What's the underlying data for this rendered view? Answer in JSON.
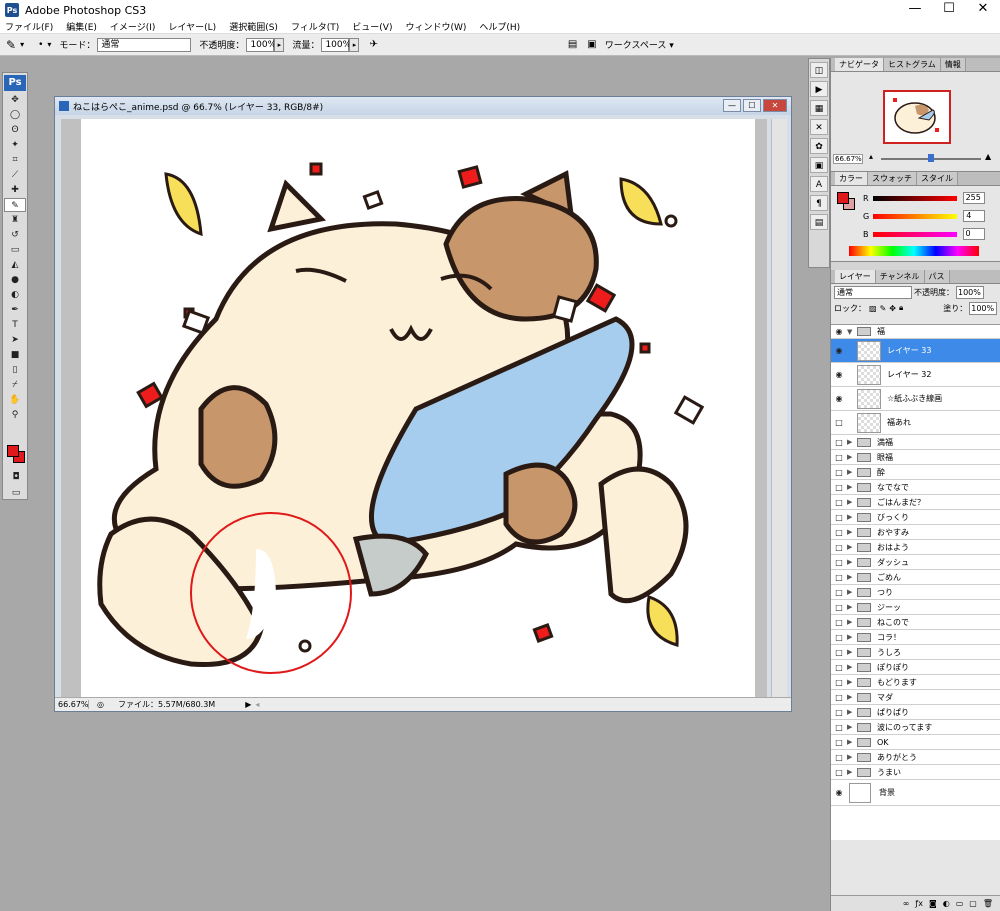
{
  "app": {
    "title": "Adobe Photoshop CS3",
    "logo": "Ps"
  },
  "window_controls": {
    "minimize": "—",
    "maximize": "☐",
    "close": "✕"
  },
  "menu": [
    "ファイル(F)",
    "編集(E)",
    "イメージ(I)",
    "レイヤー(L)",
    "選択範囲(S)",
    "フィルタ(T)",
    "ビュー(V)",
    "ウィンドウ(W)",
    "ヘルプ(H)"
  ],
  "options": {
    "mode_label": "モード：",
    "mode_value": "通常",
    "opacity_label": "不透明度：",
    "opacity_value": "100%",
    "flow_label": "流量：",
    "flow_value": "100%",
    "workspace_label": "ワークスペース ▾"
  },
  "toolbox": {
    "logo": "Ps"
  },
  "document": {
    "title": "ねこはらぺこ_anime.psd @ 66.7% (レイヤー 33, RGB/8#)",
    "zoom": "66.67%",
    "file_info": "ファイル：5.57M/680.3M"
  },
  "navigator": {
    "tabs": [
      "ナビゲータ",
      "ヒストグラム",
      "情報"
    ],
    "zoom": "66.67%"
  },
  "color": {
    "tabs": [
      "カラー",
      "スウォッチ",
      "スタイル"
    ],
    "r_label": "R",
    "r_value": "255",
    "g_label": "G",
    "g_value": "4",
    "b_label": "B",
    "b_value": "0",
    "fg": "#e0191c"
  },
  "layers": {
    "tabs": [
      "レイヤー",
      "チャンネル",
      "パス"
    ],
    "blend_mode": "通常",
    "opacity_label": "不透明度：",
    "opacity_value": "100%",
    "lock_label": "ロック：",
    "fill_label": "塗り：",
    "fill_value": "100%",
    "items": [
      {
        "name": "福",
        "type": "group",
        "visible": true,
        "open": true
      },
      {
        "name": "レイヤー 33",
        "type": "layer",
        "visible": true,
        "selected": true
      },
      {
        "name": "レイヤー 32",
        "type": "layer",
        "visible": true
      },
      {
        "name": "☆紙ふぶき線画",
        "type": "layer",
        "visible": true
      },
      {
        "name": "福あれ",
        "type": "layer",
        "visible": false
      },
      {
        "name": "満福",
        "type": "group",
        "visible": false
      },
      {
        "name": "眼福",
        "type": "group",
        "visible": false
      },
      {
        "name": "酔",
        "type": "group",
        "visible": false
      },
      {
        "name": "なでなで",
        "type": "group",
        "visible": false
      },
      {
        "name": "ごはんまだ？",
        "type": "group",
        "visible": false
      },
      {
        "name": "びっくり",
        "type": "group",
        "visible": false
      },
      {
        "name": "おやすみ",
        "type": "group",
        "visible": false
      },
      {
        "name": "おはよう",
        "type": "group",
        "visible": false
      },
      {
        "name": "ダッシュ",
        "type": "group",
        "visible": false
      },
      {
        "name": "ごめん",
        "type": "group",
        "visible": false
      },
      {
        "name": "つり",
        "type": "group",
        "visible": false
      },
      {
        "name": "ジーッ",
        "type": "group",
        "visible": false
      },
      {
        "name": "ねこので",
        "type": "group",
        "visible": false
      },
      {
        "name": "コラ！",
        "type": "group",
        "visible": false
      },
      {
        "name": "うしろ",
        "type": "group",
        "visible": false
      },
      {
        "name": "ぽりぽり",
        "type": "group",
        "visible": false
      },
      {
        "name": "もどります",
        "type": "group",
        "visible": false
      },
      {
        "name": "マダ",
        "type": "group",
        "visible": false
      },
      {
        "name": "ぱりぱり",
        "type": "group",
        "visible": false
      },
      {
        "name": "波にのってます",
        "type": "group",
        "visible": false
      },
      {
        "name": "OK",
        "type": "group",
        "visible": false
      },
      {
        "name": "ありがとう",
        "type": "group",
        "visible": false
      },
      {
        "name": "うまい",
        "type": "group",
        "visible": false
      },
      {
        "name": "背景",
        "type": "background",
        "visible": true
      }
    ]
  }
}
